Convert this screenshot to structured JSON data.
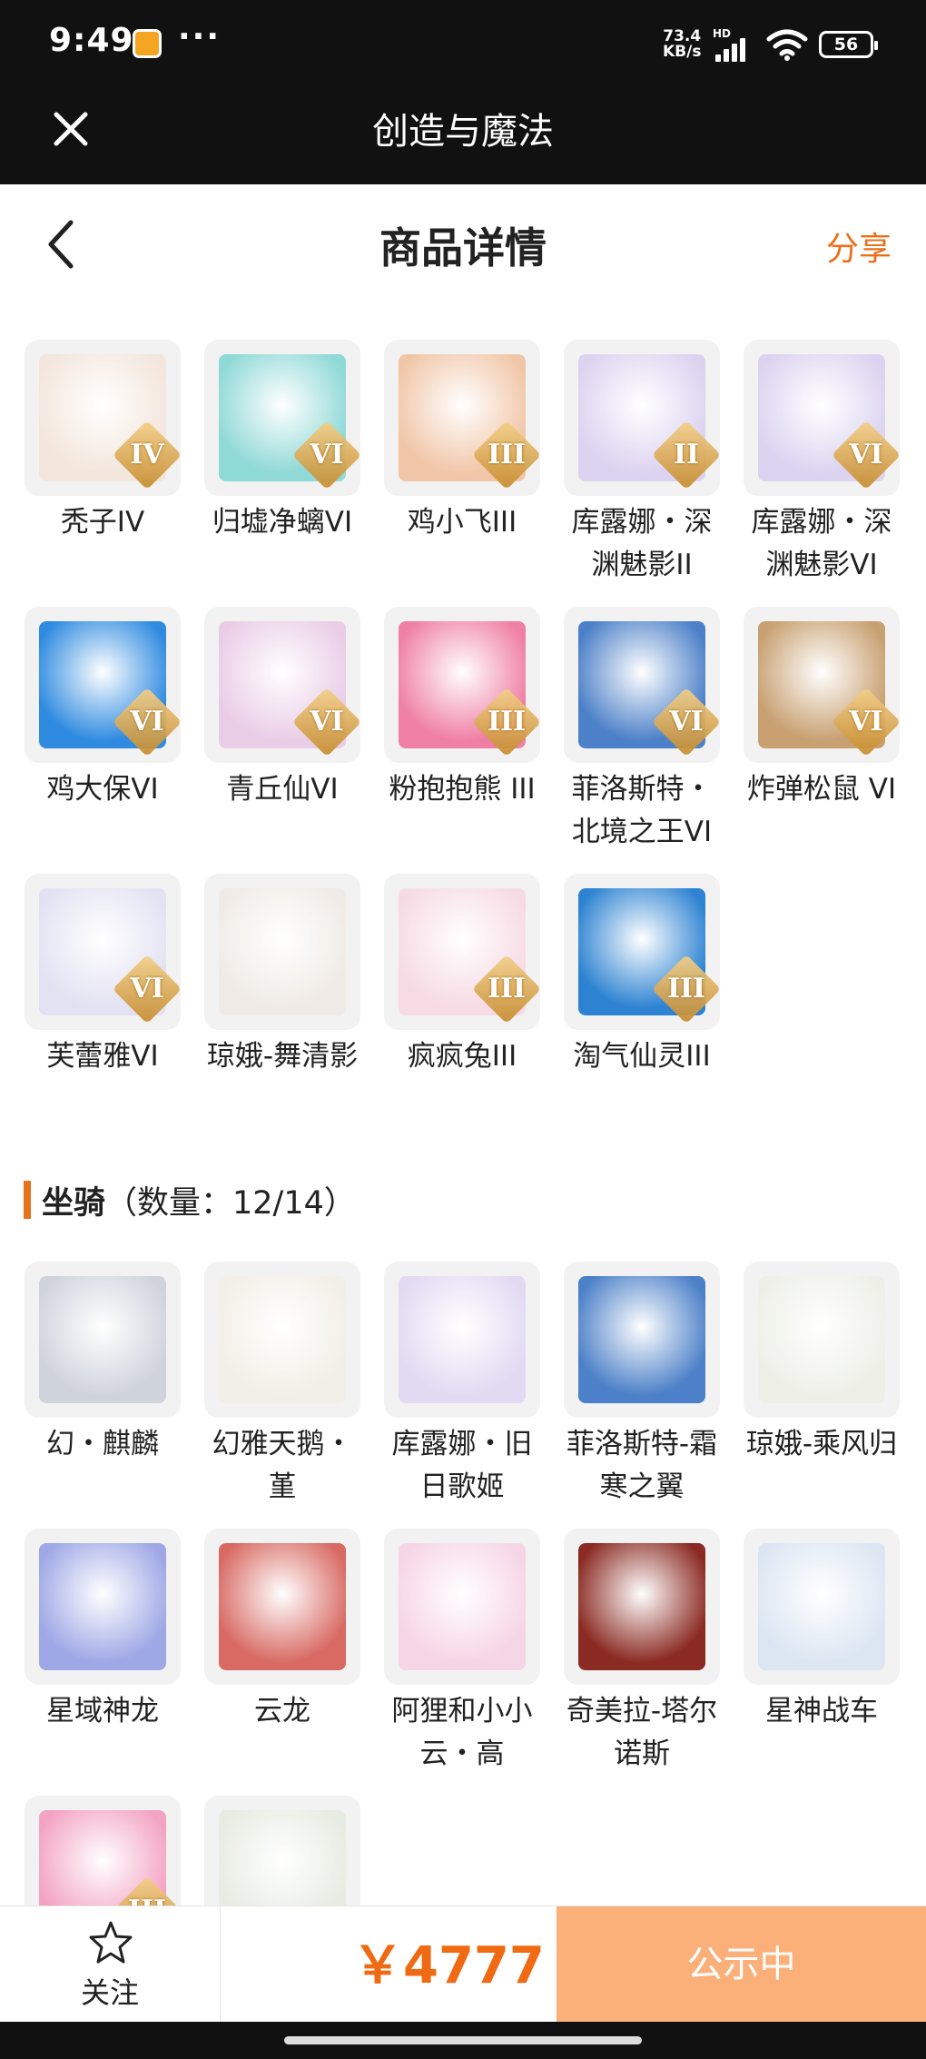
{
  "status": {
    "time": "9:49",
    "dots": "···",
    "speed_value": "73.4",
    "speed_unit": "KB/s",
    "hd": "HD",
    "battery": "56"
  },
  "appbar": {
    "title": "创造与魔法",
    "close_icon": "close-icon"
  },
  "navbar": {
    "title": "商品详情",
    "share": "分享",
    "back_icon": "chevron-left-icon"
  },
  "pets": [
    {
      "name": "秃子IV",
      "badge": "IV",
      "color": "#f3e6dc"
    },
    {
      "name": "归墟净螭VI",
      "badge": "VI",
      "color": "#8fd9d6"
    },
    {
      "name": "鸡小飞III",
      "badge": "III",
      "color": "#f1c6a8"
    },
    {
      "name": "库露娜・深渊魅影II",
      "badge": "II",
      "color": "#dcd3f0"
    },
    {
      "name": "库露娜・深渊魅影VI",
      "badge": "VI",
      "color": "#dcd3f0"
    },
    {
      "name": "鸡大保VI",
      "badge": "VI",
      "color": "#2f8be0"
    },
    {
      "name": "青丘仙VI",
      "badge": "VI",
      "color": "#e9cde6"
    },
    {
      "name": "粉抱抱熊 III",
      "badge": "III",
      "color": "#ef7fa4"
    },
    {
      "name": "菲洛斯特・北境之王VI",
      "badge": "VI",
      "color": "#4c80c8"
    },
    {
      "name": "炸弹松鼠 VI",
      "badge": "VI",
      "color": "#c8a071"
    },
    {
      "name": "芙蕾雅VI",
      "badge": "VI",
      "color": "#e3e2f2"
    },
    {
      "name": "琼娥-舞清影",
      "badge": "",
      "color": "#f0ebe6"
    },
    {
      "name": "疯疯兔III",
      "badge": "III",
      "color": "#f6dbe4"
    },
    {
      "name": "淘气仙灵III",
      "badge": "III",
      "color": "#2d83d2"
    }
  ],
  "mounts_section": {
    "label": "坐骑",
    "count": "（数量：12/14）"
  },
  "mounts": [
    {
      "name": "幻・麒麟",
      "badge": "",
      "color": "#cfd3dc"
    },
    {
      "name": "幻雅天鹅・堇",
      "badge": "",
      "color": "#f2efe6"
    },
    {
      "name": "库露娜・旧日歌姬",
      "badge": "",
      "color": "#e2daf2"
    },
    {
      "name": "菲洛斯特-霜寒之翼",
      "badge": "",
      "color": "#4c80c8"
    },
    {
      "name": "琼娥-乘风归",
      "badge": "",
      "color": "#eef0e8"
    },
    {
      "name": "星域神龙",
      "badge": "",
      "color": "#9fa8e6"
    },
    {
      "name": "云龙",
      "badge": "",
      "color": "#d86a63"
    },
    {
      "name": "阿狸和小小云・高",
      "badge": "",
      "color": "#f6d5e6"
    },
    {
      "name": "奇美拉-塔尔诺斯",
      "badge": "",
      "color": "#8a2a22"
    },
    {
      "name": "星神战车",
      "badge": "",
      "color": "#dce6f2"
    },
    {
      "name": "",
      "badge": "III",
      "color": "#f3a3c4"
    },
    {
      "name": "",
      "badge": "",
      "color": "#e6ece2"
    }
  ],
  "bottom": {
    "follow": "关注",
    "follow_icon": "star-icon",
    "price": "￥4777",
    "button": "公示中"
  }
}
